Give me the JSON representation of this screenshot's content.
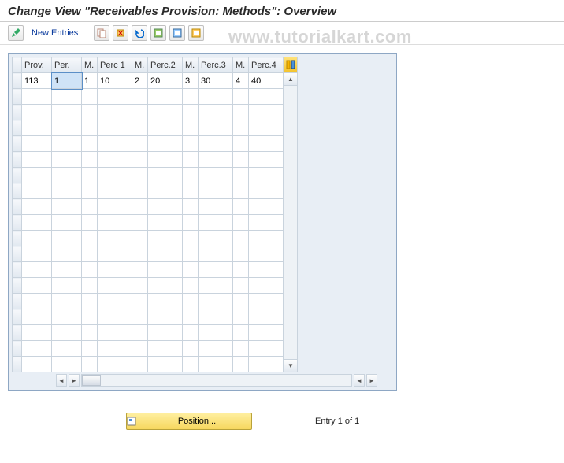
{
  "title": "Change View \"Receivables Provision: Methods\": Overview",
  "watermark": "www.tutorialkart.com",
  "toolbar": {
    "new_entries_label": "New Entries"
  },
  "table": {
    "columns": [
      "Prov.",
      "Per.",
      "M.",
      "Perc 1",
      "M.",
      "Perc.2",
      "M.",
      "Perc.3",
      "M.",
      "Perc.4"
    ],
    "rows": [
      {
        "prov": "113",
        "per": "1",
        "m1": "1",
        "p1": "10",
        "m2": "2",
        "p2": "20",
        "m3": "3",
        "p3": "30",
        "m4": "4",
        "p4": "40"
      }
    ],
    "empty_row_count": 18
  },
  "footer": {
    "position_label": "Position...",
    "entry_text": "Entry 1 of 1"
  }
}
